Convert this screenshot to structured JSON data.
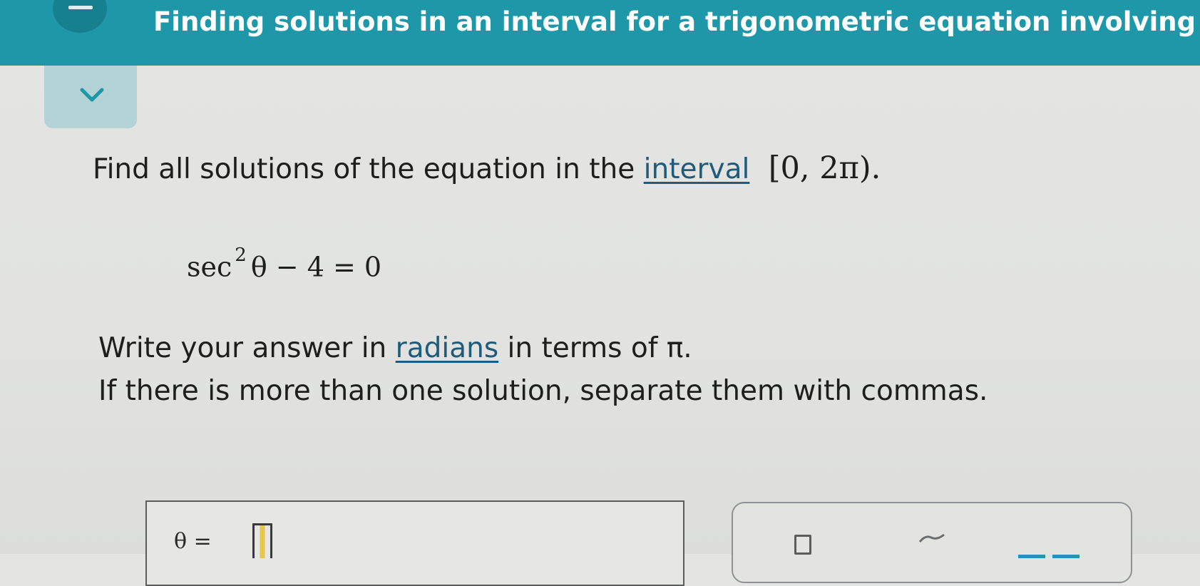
{
  "header": {
    "title": "Finding solutions in an interval for a trigonometric equation involving a...",
    "menu_icon": "hamburger-icon",
    "collapse_icon": "chevron-down-icon"
  },
  "problem": {
    "prompt_before": "Find all solutions of the equation in the",
    "prompt_link": "interval",
    "interval": "[0, 2π).",
    "equation": {
      "sec": "sec",
      "exponent": "2",
      "rest": "θ − 4 = 0"
    },
    "instruction1_before": "Write your answer in",
    "instruction1_link": "radians",
    "instruction1_after": "in terms of π.",
    "instruction2": "If there is more than one solution, separate them with commas."
  },
  "answer": {
    "label": "θ =",
    "value": ""
  },
  "tools": {
    "fraction_icon": "fraction-box-icon",
    "pi_icon": "pi-icon",
    "mixed_icon": "mixed-number-icon"
  },
  "colors": {
    "header_bg": "#1e97a8",
    "tab_bg": "#b4d3d7",
    "link": "#1f5b7a",
    "cursor": "#e5c64a"
  }
}
